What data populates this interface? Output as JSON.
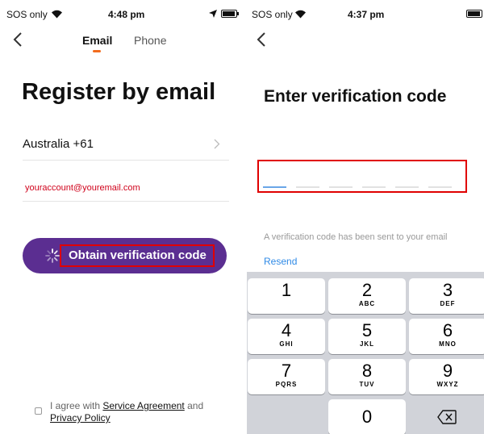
{
  "left": {
    "status": {
      "carrier": "SOS only",
      "time": "4:48 pm"
    },
    "tabs": [
      {
        "label": "Email"
      },
      {
        "label": "Phone"
      }
    ],
    "title": "Register by email",
    "country": {
      "label": "Australia +61"
    },
    "email_value": "youraccount@youremail.com",
    "obtain_button": "Obtain verification code",
    "agreement": {
      "prefix": "I agree with ",
      "service_link": "Service Agreement",
      "and": " and",
      "privacy_link": "Privacy Policy"
    }
  },
  "right": {
    "status": {
      "carrier": "SOS only",
      "time": "4:37 pm"
    },
    "title": "Enter verification code",
    "info": "A verification code has been sent to your email",
    "resend": "Resend",
    "keypad": [
      {
        "num": "1",
        "letters": ""
      },
      {
        "num": "2",
        "letters": "ABC"
      },
      {
        "num": "3",
        "letters": "DEF"
      },
      {
        "num": "4",
        "letters": "GHI"
      },
      {
        "num": "5",
        "letters": "JKL"
      },
      {
        "num": "6",
        "letters": "MNO"
      },
      {
        "num": "7",
        "letters": "PQRS"
      },
      {
        "num": "8",
        "letters": "TUV"
      },
      {
        "num": "9",
        "letters": "WXYZ"
      },
      {
        "num": "0",
        "letters": ""
      }
    ]
  },
  "colors": {
    "accent_orange": "#f26b1d",
    "button_purple": "#5b2e91",
    "highlight_red": "#e00000",
    "link_blue": "#2f8ae6",
    "email_red": "#d0021b",
    "keyboard_bg": "#d1d3d9"
  },
  "icons": [
    "wifi-icon",
    "location-arrow-icon",
    "battery-icon",
    "back-chevron-icon",
    "chevron-right-icon",
    "spinner-icon",
    "checkbox-icon",
    "backspace-icon"
  ]
}
